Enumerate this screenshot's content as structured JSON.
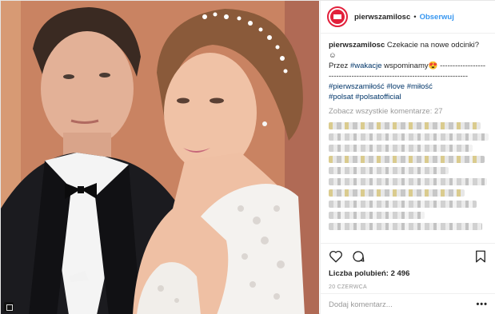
{
  "post": {
    "username": "pierwszamilosc",
    "separator": "•",
    "follow_label": "Obserwuj",
    "caption": {
      "author": "pierwszamilosc",
      "line1": "Czekacie na nowe odcinki? ☺",
      "line2_prefix": "Przez ",
      "line2_tag": "#wakacje",
      "line2_suffix": " wspominamy😍 -------------------------------------------------------------------------",
      "tags": [
        "#pierwszamiłość",
        "#love",
        "#miłość",
        "#polsat",
        "#polsatofficial"
      ]
    },
    "view_all_comments": "Zobacz wszystkie komentarze: 27",
    "likes": "Liczba polubień: 2 496",
    "date": "20 CZERWCA",
    "add_comment_placeholder": "Dodaj komentarz...",
    "more_label": "•••"
  },
  "icons": {
    "like": "heart-icon",
    "comment": "comment-icon",
    "save": "bookmark-icon",
    "avatar": "brand-logo"
  },
  "colors": {
    "follow": "#3897f0",
    "hashtag": "#003569",
    "brand": "#e2203b",
    "muted": "#999999"
  }
}
